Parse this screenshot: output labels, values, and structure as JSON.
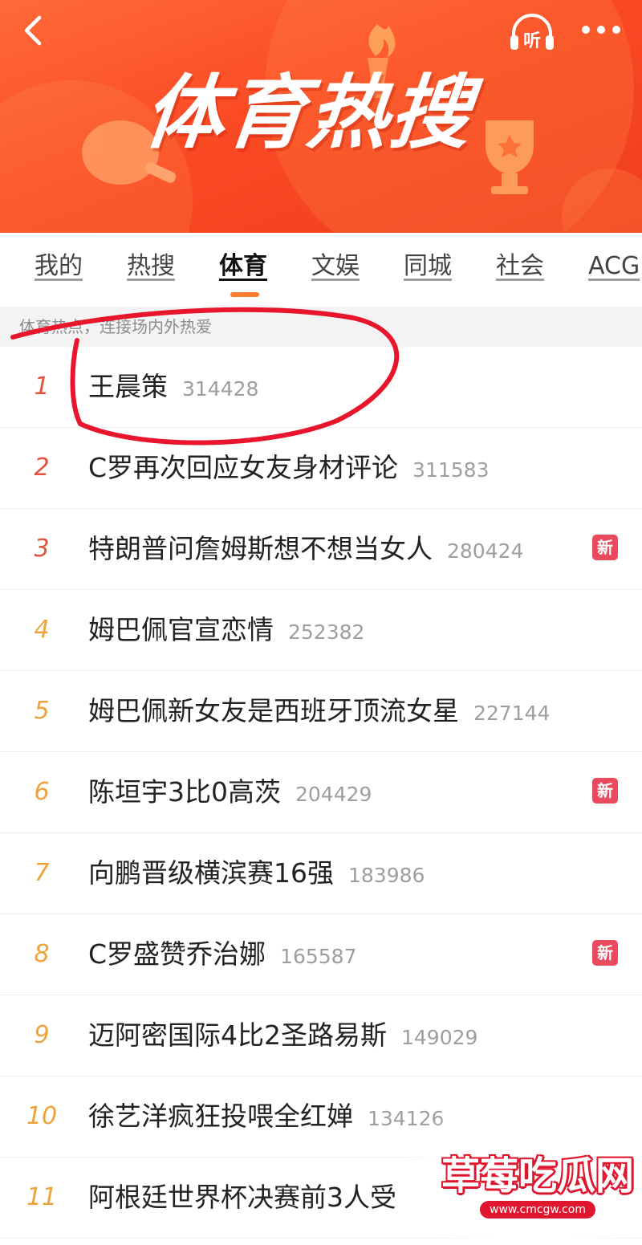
{
  "colors": {
    "banner_bg": "#fb4a23",
    "tab_indicator": "#ff7d2e",
    "rank_top": "#e2523c",
    "rank_other": "#f0a23a",
    "badge_new": "#ea4a5e",
    "annotation": "#e8152d",
    "watermark_red": "#e0162e"
  },
  "icons": {
    "back": "back-arrow-icon",
    "listen": "headphones-icon",
    "more": "more-dots-icon"
  },
  "header": {
    "title": "体育热搜",
    "listen_label": "听"
  },
  "tabs": [
    {
      "label": "我的",
      "active": false
    },
    {
      "label": "热搜",
      "active": false
    },
    {
      "label": "体育",
      "active": true
    },
    {
      "label": "文娱",
      "active": false
    },
    {
      "label": "同城",
      "active": false
    },
    {
      "label": "社会",
      "active": false
    },
    {
      "label": "ACG",
      "active": false
    }
  ],
  "subtitle": "体育热点，连接场内外热爱",
  "list": [
    {
      "rank": "1",
      "topic": "王晨策",
      "heat": "314428",
      "badge": ""
    },
    {
      "rank": "2",
      "topic": "C罗再次回应女友身材评论",
      "heat": "311583",
      "badge": ""
    },
    {
      "rank": "3",
      "topic": "特朗普问詹姆斯想不想当女人",
      "heat": "280424",
      "badge": "新"
    },
    {
      "rank": "4",
      "topic": "姆巴佩官宣恋情",
      "heat": "252382",
      "badge": ""
    },
    {
      "rank": "5",
      "topic": "姆巴佩新女友是西班牙顶流女星",
      "heat": "227144",
      "badge": ""
    },
    {
      "rank": "6",
      "topic": "陈垣宇3比0高茨",
      "heat": "204429",
      "badge": "新"
    },
    {
      "rank": "7",
      "topic": "向鹏晋级横滨赛16强",
      "heat": "183986",
      "badge": ""
    },
    {
      "rank": "8",
      "topic": "C罗盛赞乔治娜",
      "heat": "165587",
      "badge": "新"
    },
    {
      "rank": "9",
      "topic": "迈阿密国际4比2圣路易斯",
      "heat": "149029",
      "badge": ""
    },
    {
      "rank": "10",
      "topic": "徐艺洋疯狂投喂全红婵",
      "heat": "134126",
      "badge": ""
    },
    {
      "rank": "11",
      "topic": "阿根廷世界杯决赛前3人受",
      "heat": "",
      "badge": ""
    }
  ],
  "watermark": {
    "title": "草莓吃瓜网",
    "url": "www.cmcgw.com"
  }
}
